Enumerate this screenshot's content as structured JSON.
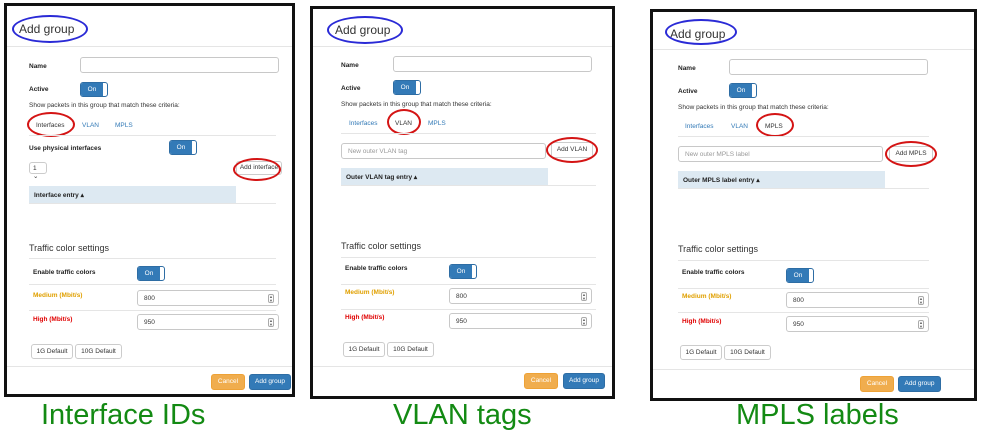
{
  "panels": [
    {
      "title": "Add group",
      "name_label": "Name",
      "active_label": "Active",
      "toggle_on": "On",
      "criteria_text": "Show packets in this group that match these criteria:",
      "tabs": [
        "Interfaces",
        "VLAN",
        "MPLS"
      ],
      "active_tab": 0,
      "physical_label": "Use physical interfaces",
      "select_value": "1",
      "add_button": "Add interface",
      "table_header": "Interface entry",
      "traffic_title": "Traffic color settings",
      "enable_colors": "Enable traffic colors",
      "medium_label": "Medium (Mbit/s)",
      "medium_value": "800",
      "high_label": "High (Mbit/s)",
      "high_value": "950",
      "default_1g": "1G Default",
      "default_10g": "10G Default",
      "cancel": "Cancel",
      "submit": "Add group",
      "caption": "Interface IDs"
    },
    {
      "title": "Add group",
      "name_label": "Name",
      "active_label": "Active",
      "toggle_on": "On",
      "criteria_text": "Show packets in this group that match these criteria:",
      "tabs": [
        "Interfaces",
        "VLAN",
        "MPLS"
      ],
      "active_tab": 1,
      "input_placeholder": "New outer VLAN tag",
      "add_button": "Add VLAN",
      "table_header": "Outer VLAN tag entry",
      "traffic_title": "Traffic color settings",
      "enable_colors": "Enable traffic colors",
      "medium_label": "Medium (Mbit/s)",
      "medium_value": "800",
      "high_label": "High (Mbit/s)",
      "high_value": "950",
      "default_1g": "1G Default",
      "default_10g": "10G Default",
      "cancel": "Cancel",
      "submit": "Add group",
      "caption": "VLAN tags"
    },
    {
      "title": "Add group",
      "name_label": "Name",
      "active_label": "Active",
      "toggle_on": "On",
      "criteria_text": "Show packets in this group that match these criteria:",
      "tabs": [
        "Interfaces",
        "VLAN",
        "MPLS"
      ],
      "active_tab": 2,
      "input_placeholder": "New outer MPLS label",
      "add_button": "Add MPLS",
      "table_header": "Outer MPLS label entry",
      "traffic_title": "Traffic color settings",
      "enable_colors": "Enable traffic colors",
      "medium_label": "Medium (Mbit/s)",
      "medium_value": "800",
      "high_label": "High (Mbit/s)",
      "high_value": "950",
      "default_1g": "1G Default",
      "default_10g": "10G Default",
      "cancel": "Cancel",
      "submit": "Add group",
      "caption": "MPLS labels"
    }
  ],
  "colors": {
    "primary": "#337ab7",
    "cancel": "#f0ad4e",
    "medium": "#e0a000",
    "high": "#e00000",
    "caption": "#138a13",
    "highlight_red": "#d41414",
    "highlight_blue": "#2a2ad6"
  }
}
